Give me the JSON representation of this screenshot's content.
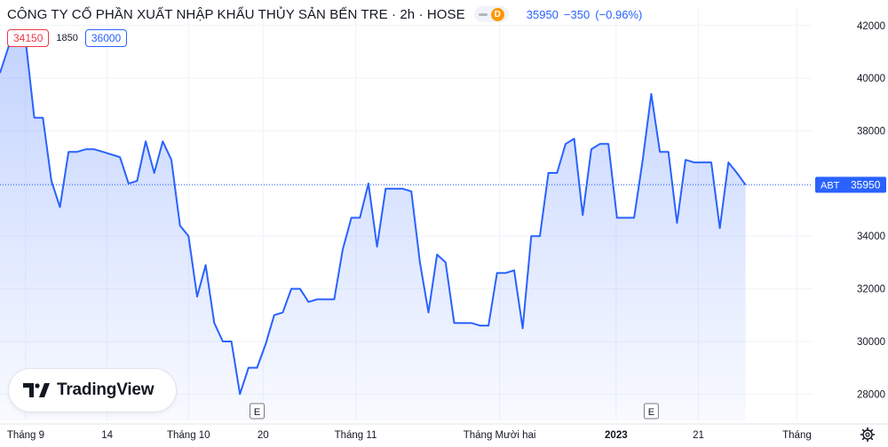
{
  "header": {
    "title": "CÔNG TY CỔ PHẦN XUẤT NHẬP KHẨU THỦY SẢN BẾN TRE · 2h · HOSE",
    "badge_letter": "D",
    "last": "35950",
    "change": "−350",
    "change_pct": "(−0.96%)",
    "bid": "34150",
    "spread": "1850",
    "ask": "36000"
  },
  "price_tag": {
    "symbol": "ABT",
    "value": "35950"
  },
  "logo": {
    "text": "TradingView"
  },
  "colors": {
    "line": "#2962ff",
    "fill": "#2962ff",
    "grid": "#f0f3fa",
    "text": "#131722",
    "bid": "#f23645",
    "tag_bg": "#2962ff"
  },
  "icons": {
    "settings": "gear-icon",
    "earnings": "earnings-marker-icon"
  },
  "chart_data": {
    "type": "area",
    "title": "",
    "xlabel": "",
    "ylabel": "",
    "ylim": [
      27000,
      42700
    ],
    "y_ticks": [
      28000,
      30000,
      32000,
      34000,
      36000,
      38000,
      40000,
      42000
    ],
    "x_tick_labels": [
      {
        "label": "Tháng 9",
        "i": 3
      },
      {
        "label": "14",
        "i": 12.5
      },
      {
        "label": "Tháng 10",
        "i": 22
      },
      {
        "label": "20",
        "i": 30.7
      },
      {
        "label": "Tháng 11",
        "i": 41.5
      },
      {
        "label": "Tháng Mười hai",
        "i": 58.3
      },
      {
        "label": "2023",
        "i": 71.9
      },
      {
        "label": "21",
        "i": 81.5
      },
      {
        "label": "Tháng",
        "i": 93
      }
    ],
    "x_range": [
      0,
      100
    ],
    "earnings_markers": [
      30,
      76
    ],
    "series": [
      {
        "values": [
          40200,
          41200,
          41800,
          41400,
          38500,
          38500,
          36100,
          35100,
          37200,
          37200,
          37300,
          37300,
          37200,
          37100,
          37000,
          36000,
          36100,
          37600,
          36400,
          37600,
          36900,
          34400,
          34000,
          31700,
          32900,
          30700,
          30000,
          30000,
          28000,
          29000,
          29000,
          29900,
          31000,
          31100,
          32000,
          32000,
          31500,
          31600,
          31600,
          31600,
          33500,
          34700,
          34700,
          36000,
          33600,
          35800,
          35800,
          35800,
          35700,
          33000,
          31100,
          33300,
          33000,
          30700,
          30700,
          30700,
          30600,
          30600,
          32600,
          32600,
          32700,
          30500,
          34000,
          34000,
          36400,
          36400,
          37500,
          37700,
          34800,
          37300,
          37500,
          37500,
          34700,
          34700,
          34700,
          36900,
          39400,
          37200,
          37200,
          34500,
          36900,
          36800,
          36800,
          36800,
          34300,
          36800,
          36400,
          35950
        ]
      }
    ],
    "last_value": 35950,
    "legend": "none",
    "grid": true
  }
}
